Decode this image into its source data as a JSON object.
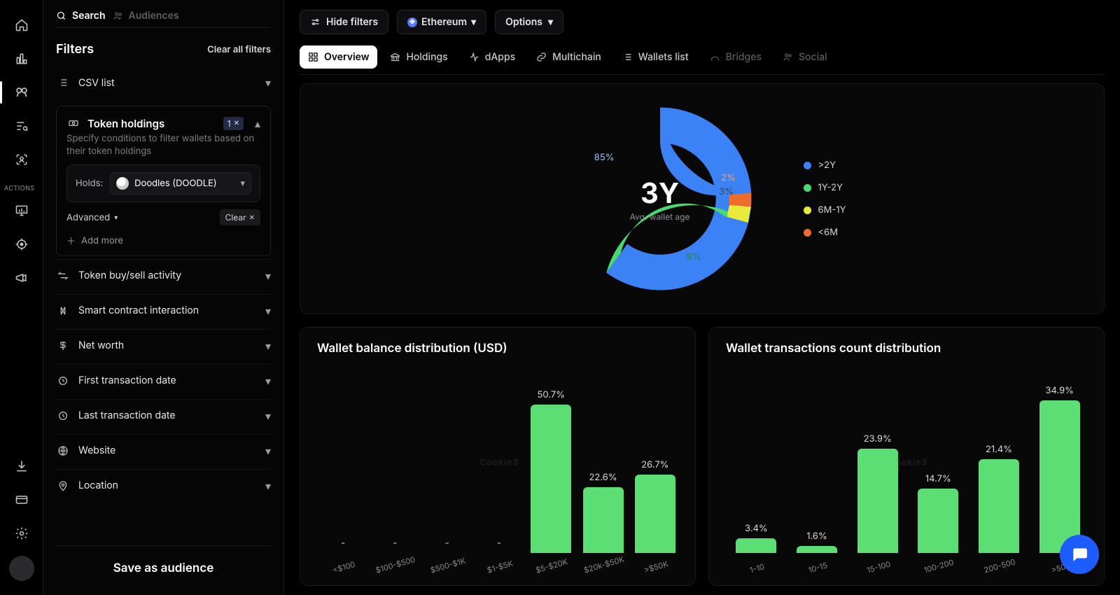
{
  "rail": {
    "actions_heading": "ACTIONS"
  },
  "sidebar": {
    "tab_search": "Search",
    "tab_audiences": "Audiences",
    "filters_title": "Filters",
    "clear_all": "Clear all filters",
    "csv": "CSV list",
    "token_holdings": {
      "title": "Token holdings",
      "badge": "1",
      "desc": "Specify conditions to filter wallets based on their token holdings",
      "holds_label": "Holds:",
      "chip": "Doodles (DOODLE)",
      "advanced": "Advanced",
      "clear": "Clear",
      "add_more": "Add more"
    },
    "rows": {
      "buy_sell": "Token buy/sell activity",
      "smart_contract": "Smart contract interaction",
      "net_worth": "Net worth",
      "first_tx": "First transaction date",
      "last_tx": "Last transaction date",
      "website": "Website",
      "location": "Location"
    },
    "save": "Save as audience"
  },
  "toolbar": {
    "hide": "Hide filters",
    "network": "Ethereum",
    "options": "Options"
  },
  "tabs": {
    "overview": "Overview",
    "holdings": "Holdings",
    "dapps": "dApps",
    "multichain": "Multichain",
    "wallets": "Wallets list",
    "bridges": "Bridges",
    "social": "Social"
  },
  "donut": {
    "center_value": "3Y",
    "center_sub": "Avg. wallet age",
    "slice_labels": {
      "s85": "85%",
      "s2": "2%",
      "s3": "3%",
      "s9": "9%"
    }
  },
  "legend": {
    "a": ">2Y",
    "b": "1Y-2Y",
    "c": "6M-1Y",
    "d": "<6M"
  },
  "chart1": {
    "title": "Wallet balance distribution (USD)"
  },
  "chart2": {
    "title": "Wallet transactions count distribution"
  },
  "watermark": "Cookie3",
  "chart_data": [
    {
      "type": "donut",
      "title": "Avg. wallet age",
      "center_value": "3Y",
      "series": [
        {
          "name": ">2Y",
          "value": 85,
          "color": "#3b82f6"
        },
        {
          "name": "1Y-2Y",
          "value": 9,
          "color": "#49da6d"
        },
        {
          "name": "6M-1Y",
          "value": 3,
          "color": "#eaea3a"
        },
        {
          "name": "<6M",
          "value": 2,
          "color": "#ef6d2a"
        }
      ]
    },
    {
      "type": "bar",
      "title": "Wallet balance distribution (USD)",
      "categories": [
        "<$100",
        "$100-$500",
        "$500-$1K",
        "$1-$5K",
        "$5-$20K",
        "$20k-$50K",
        ">$50K"
      ],
      "values": [
        null,
        null,
        null,
        null,
        50.7,
        22.6,
        26.7
      ],
      "ylabel": "%",
      "ylim": [
        0,
        55
      ]
    },
    {
      "type": "bar",
      "title": "Wallet transactions count distribution",
      "categories": [
        "1-10",
        "10-15",
        "15-100",
        "100-200",
        "200-500",
        ">500"
      ],
      "values": [
        3.4,
        1.6,
        23.9,
        14.7,
        21.4,
        34.9
      ],
      "ylabel": "%",
      "ylim": [
        0,
        40
      ]
    }
  ]
}
